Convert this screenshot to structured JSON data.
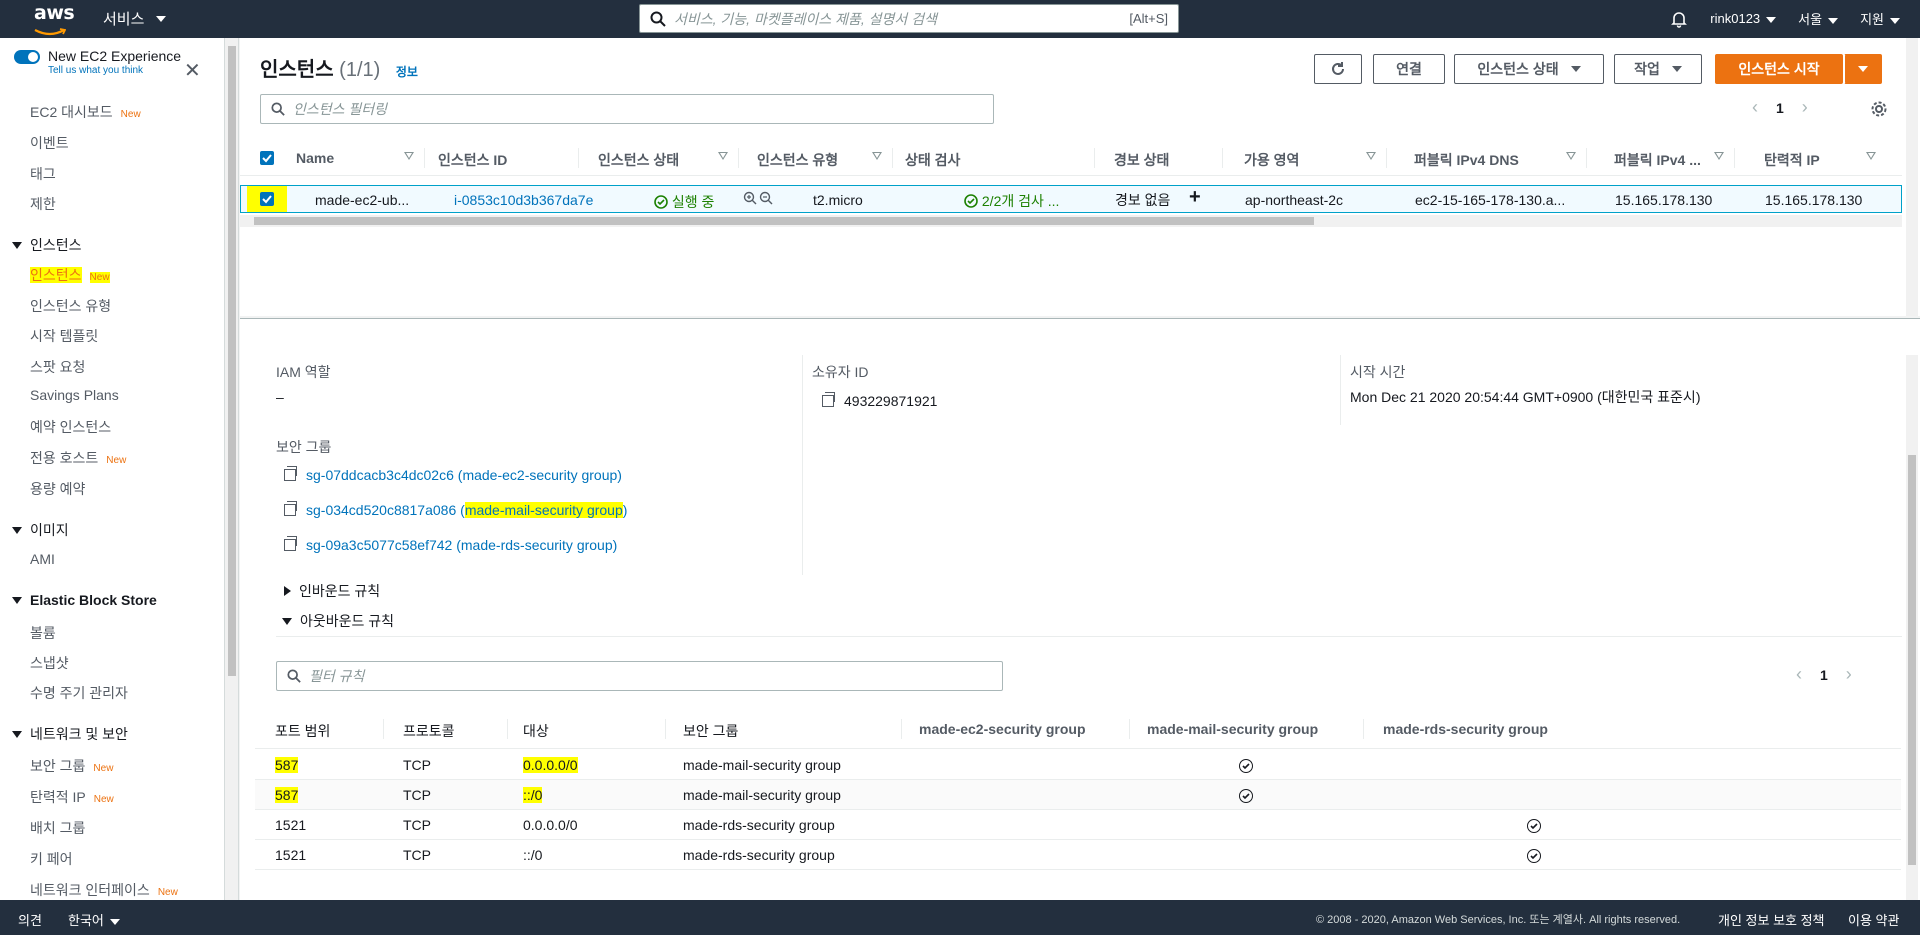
{
  "nav": {
    "logo": "aws",
    "services": "서비스",
    "search_placeholder": "서비스, 기능, 마켓플레이스 제품, 설명서 검색",
    "search_shortcut": "[Alt+S]",
    "user": "rink0123",
    "region": "서울",
    "support": "지원"
  },
  "sidebar": {
    "new_exp_title": "New EC2 Experience",
    "new_exp_sub": "Tell us what you think",
    "new_badge": "New",
    "dashboard": "EC2 대시보드",
    "events": "이벤트",
    "tags": "태그",
    "limits": "제한",
    "sec_instances": "인스턴스",
    "instances": "인스턴스",
    "instance_types": "인스턴스 유형",
    "launch_templates": "시작 템플릿",
    "spot": "스팟 요청",
    "savings": "Savings Plans",
    "reserved": "예약 인스턴스",
    "dedicated": "전용 호스트",
    "capacity": "용량 예약",
    "sec_images": "이미지",
    "ami": "AMI",
    "sec_ebs": "Elastic Block Store",
    "volumes": "볼륨",
    "snapshots": "스냅샷",
    "lifecycle": "수명 주기 관리자",
    "sec_network": "네트워크 및 보안",
    "security_groups": "보안 그룹",
    "elastic_ip": "탄력적 IP",
    "placement": "배치 그룹",
    "key_pairs": "키 페어",
    "net_interfaces": "네트워크 인터페이스"
  },
  "header": {
    "title": "인스턴스",
    "count": "(1/1)",
    "info": "정보",
    "connect": "연결",
    "state": "인스턴스 상태",
    "actions": "작업",
    "launch": "인스턴스 시작",
    "filter_placeholder": "인스턴스 필터링",
    "page": "1"
  },
  "instance_table": {
    "columns": [
      "Name",
      "인스턴스 ID",
      "인스턴스 상태",
      "인스턴스 유형",
      "상태 검사",
      "경보 상태",
      "가용 영역",
      "퍼블릭 IPv4 DNS",
      "퍼블릭 IPv4 ...",
      "탄력적 IP"
    ],
    "row": {
      "name": "made-ec2-ub...",
      "id": "i-0853c10d3b367da7e",
      "state": "실행 중",
      "type": "t2.micro",
      "checks": "2/2개 검사 ...",
      "alarm": "경보 없음",
      "az": "ap-northeast-2c",
      "dns": "ec2-15-165-178-130.a...",
      "ipv4": "15.165.178.130",
      "eip": "15.165.178.130"
    }
  },
  "details": {
    "iam_label": "IAM 역할",
    "iam_value": "–",
    "owner_label": "소유자 ID",
    "owner_value": "493229871921",
    "launch_label": "시작 시간",
    "launch_value": "Mon Dec 21 2020 20:54:44 GMT+0900 (대한민국 표준시)",
    "sg_label": "보안 그룹",
    "sg1_id": "sg-07ddcacb3c4dc02c6",
    "sg1_name": "(made-ec2-security group)",
    "sg2_id": "sg-034cd520c8817a086",
    "sg2_name": "made-mail-security group",
    "sg3_id": "sg-09a3c5077c58ef742",
    "sg3_name": "(made-rds-security group)",
    "inbound": "인바운드 규칙",
    "outbound": "아웃바운드 규칙",
    "rule_filter_placeholder": "필터 규칙",
    "page": "1"
  },
  "rules_table": {
    "columns": [
      "포트 범위",
      "프로토콜",
      "대상",
      "보안 그룹",
      "made-ec2-security group",
      "made-mail-security group",
      "made-rds-security group"
    ],
    "rows": [
      {
        "port": "587",
        "proto": "TCP",
        "dest": "0.0.0.0/0",
        "sg": "made-mail-security group"
      },
      {
        "port": "587",
        "proto": "TCP",
        "dest": "::/0",
        "sg": "made-mail-security group"
      },
      {
        "port": "1521",
        "proto": "TCP",
        "dest": "0.0.0.0/0",
        "sg": "made-rds-security group"
      },
      {
        "port": "1521",
        "proto": "TCP",
        "dest": "::/0",
        "sg": "made-rds-security group"
      }
    ]
  },
  "footer": {
    "feedback": "의견",
    "language": "한국어",
    "copyright": "© 2008 - 2020, Amazon Web Services, Inc. 또는 계열사. All rights reserved.",
    "privacy": "개인 정보 보호 정책",
    "terms": "이용 약관"
  },
  "colors": {
    "nav": "#232f3e",
    "primary": "#ec7211",
    "link": "#0073bb",
    "highlight": "#ffff00",
    "success": "#1d8102"
  }
}
